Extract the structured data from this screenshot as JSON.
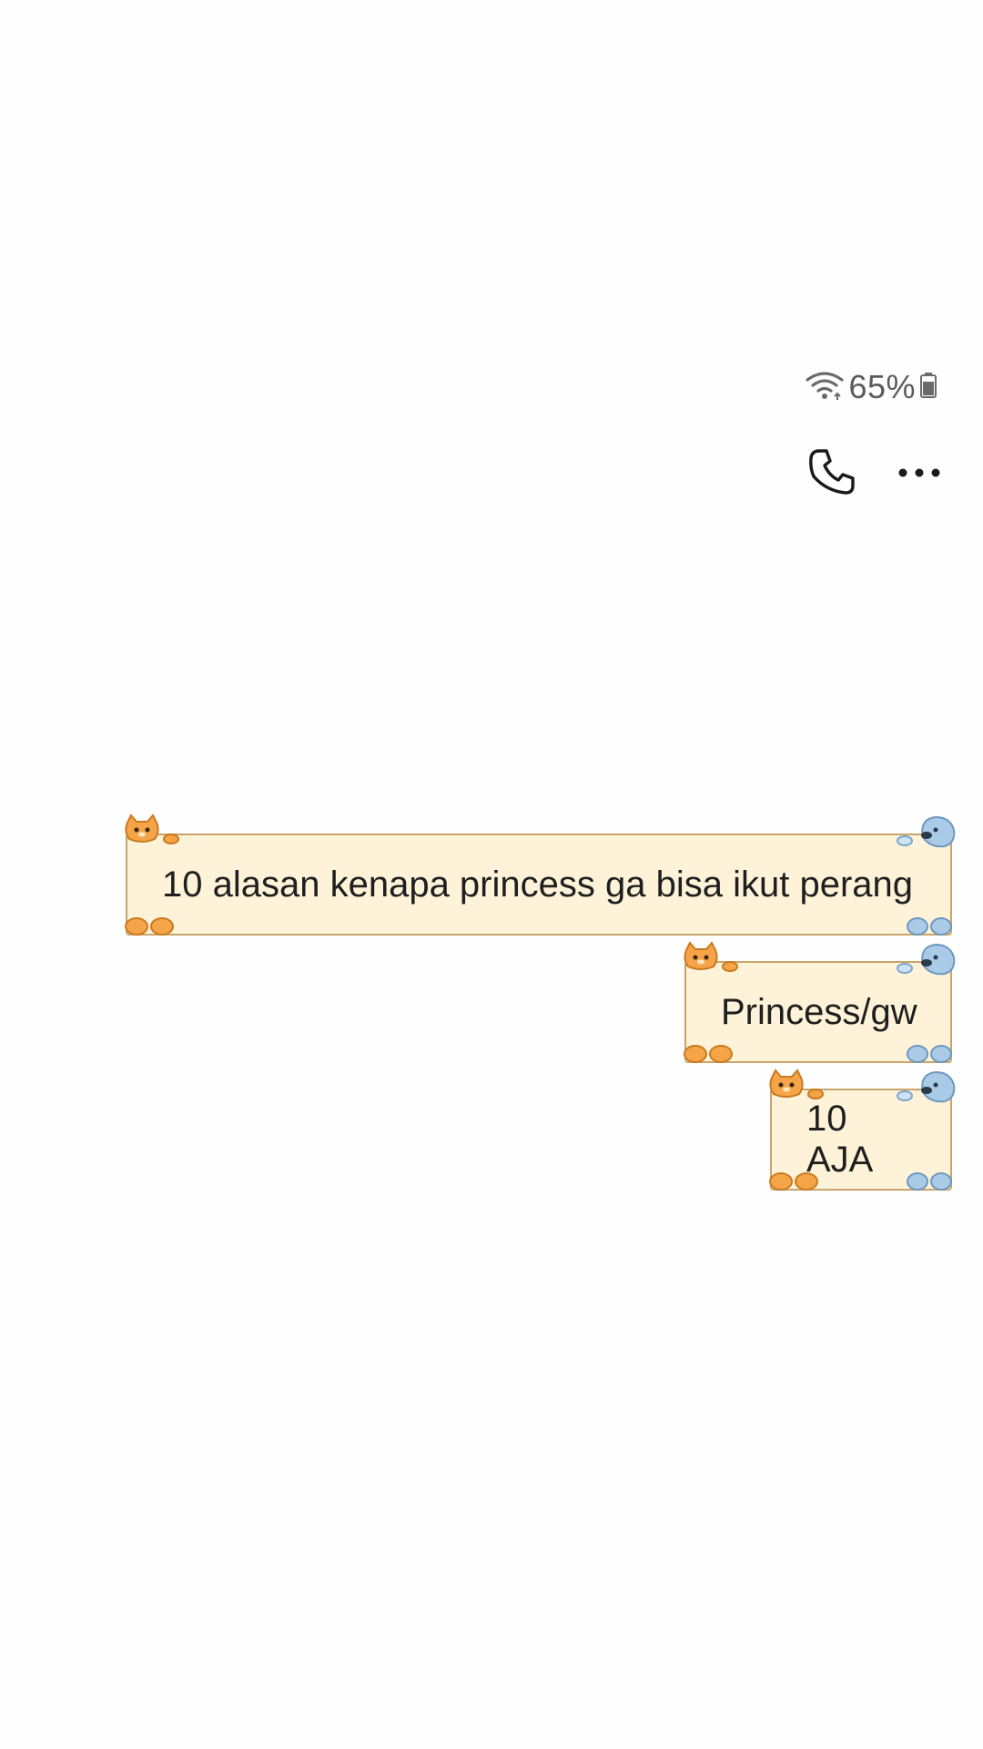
{
  "status_bar": {
    "wifi_icon": "wifi-icon",
    "battery_percent": "65%",
    "battery_icon": "battery-icon"
  },
  "header": {
    "call_icon": "phone-icon",
    "more_icon": "more-horizontal-icon"
  },
  "messages": [
    {
      "text": "10 alasan kenapa princess ga bisa ikut perang",
      "side": "right"
    },
    {
      "text": "Princess/gw",
      "side": "right"
    },
    {
      "text": "10 AJA",
      "side": "right"
    }
  ],
  "colors": {
    "bubble_bg": "#fef3d8",
    "bubble_border": "#c9a56c",
    "cat_orange": "#f5a547",
    "dog_blue": "#a9cbe8"
  }
}
